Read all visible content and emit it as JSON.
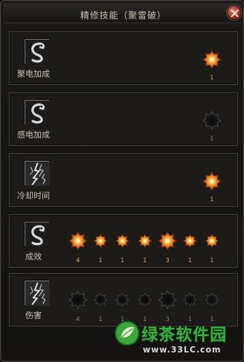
{
  "window": {
    "title": "精修技能（聚雷破）"
  },
  "rows": [
    {
      "name": "row-1",
      "label": "聚电加成",
      "icon": "serpent-icon",
      "stars": [
        {
          "lit": true,
          "count": "1"
        }
      ]
    },
    {
      "name": "row-2",
      "label": "感电加成",
      "icon": "serpent-icon",
      "stars": [
        {
          "lit": false,
          "count": "1"
        }
      ]
    },
    {
      "name": "row-3",
      "label": "冷却时间",
      "icon": "lightning-icon",
      "stars": [
        {
          "lit": true,
          "count": "1"
        }
      ]
    },
    {
      "name": "row-4",
      "label": "成效",
      "icon": "serpent-icon",
      "stars": [
        {
          "lit": true,
          "count": "4"
        },
        {
          "lit": true,
          "count": "1"
        },
        {
          "lit": true,
          "count": "1"
        },
        {
          "lit": true,
          "count": "1"
        },
        {
          "lit": true,
          "count": "3"
        },
        {
          "lit": true,
          "count": "1"
        },
        {
          "lit": true,
          "count": "1"
        }
      ]
    },
    {
      "name": "row-5",
      "label": "伤害",
      "icon": "lightning-icon",
      "stars": [
        {
          "lit": false,
          "count": "4"
        },
        {
          "lit": false,
          "count": "1"
        },
        {
          "lit": false,
          "count": "1"
        },
        {
          "lit": false,
          "count": "1"
        },
        {
          "lit": false,
          "count": "3"
        },
        {
          "lit": false,
          "count": "1"
        },
        {
          "lit": false,
          "count": "1"
        }
      ]
    }
  ],
  "watermark": {
    "text": "绿茶软件园",
    "url": "www.33LC.com"
  },
  "colors": {
    "lit_star": "#f0a030",
    "dim_star": "#141414",
    "watermark_green": "#36b33a"
  }
}
